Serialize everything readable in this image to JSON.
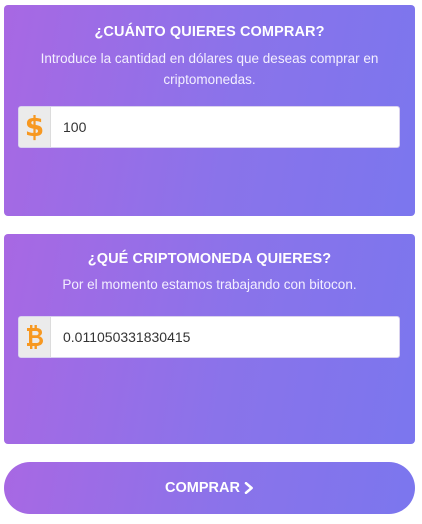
{
  "purchase_amount": {
    "title": "¿CUÁNTO QUIERES COMPRAR?",
    "description": "Introduce la cantidad en dólares que deseas comprar en criptomonedas.",
    "currency_icon": "dollar-icon",
    "value": "100"
  },
  "crypto_select": {
    "title": "¿QUÉ CRIPTOMONEDA QUIERES?",
    "description": "Por el momento estamos trabajando con bitocon.",
    "currency_icon": "bitcoin-icon",
    "value": "0.011050331830415"
  },
  "actions": {
    "buy_label": "COMPRAR",
    "buy_icon": "chevron-right-icon"
  },
  "colors": {
    "gradient_start": "#a868e3",
    "gradient_end": "#7b76ee",
    "icon_orange": "#f79820"
  }
}
